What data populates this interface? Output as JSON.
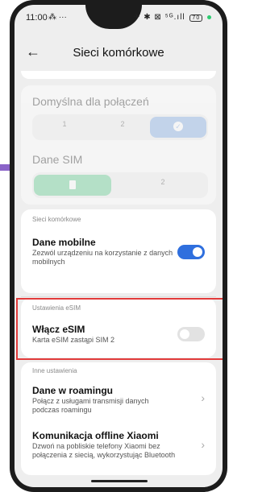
{
  "status": {
    "time": "11:00",
    "left_icons": "⁂ ···",
    "right_icons": "✈ ✱ ⊠ ⁵ᴳ.ıll",
    "battery": "70"
  },
  "header": {
    "title": "Sieci komórkowe"
  },
  "sim_defaults": {
    "calls_label": "Domyślna dla połączeń",
    "calls_options": [
      "1",
      "2"
    ],
    "data_label": "Dane SIM",
    "data_options": [
      "2"
    ]
  },
  "mobile_networks": {
    "section_label": "Sieci komórkowe",
    "mobile_data_title": "Dane mobilne",
    "mobile_data_desc": "Zezwól urządzeniu na korzystanie z danych mobilnych",
    "mobile_data_on": true
  },
  "esim": {
    "section_label": "Ustawienia eSIM",
    "title": "Włącz eSIM",
    "desc": "Karta eSIM zastąpi SIM 2",
    "enabled": false
  },
  "other": {
    "section_label": "Inne ustawienia",
    "roaming_title": "Dane w roamingu",
    "roaming_desc": "Połącz z usługami transmisji danych podczas roamingu",
    "offline_title": "Komunikacja offline Xiaomi",
    "offline_desc": "Dzwoń na pobliskie telefony Xiaomi bez połączenia z siecią, wykorzystując Bluetooth"
  },
  "colors": {
    "accent": "#2f6fde",
    "selected_pill_blue": "#8fb3e6",
    "selected_pill_green": "#6fd19a",
    "highlight": "#e23b3b"
  }
}
